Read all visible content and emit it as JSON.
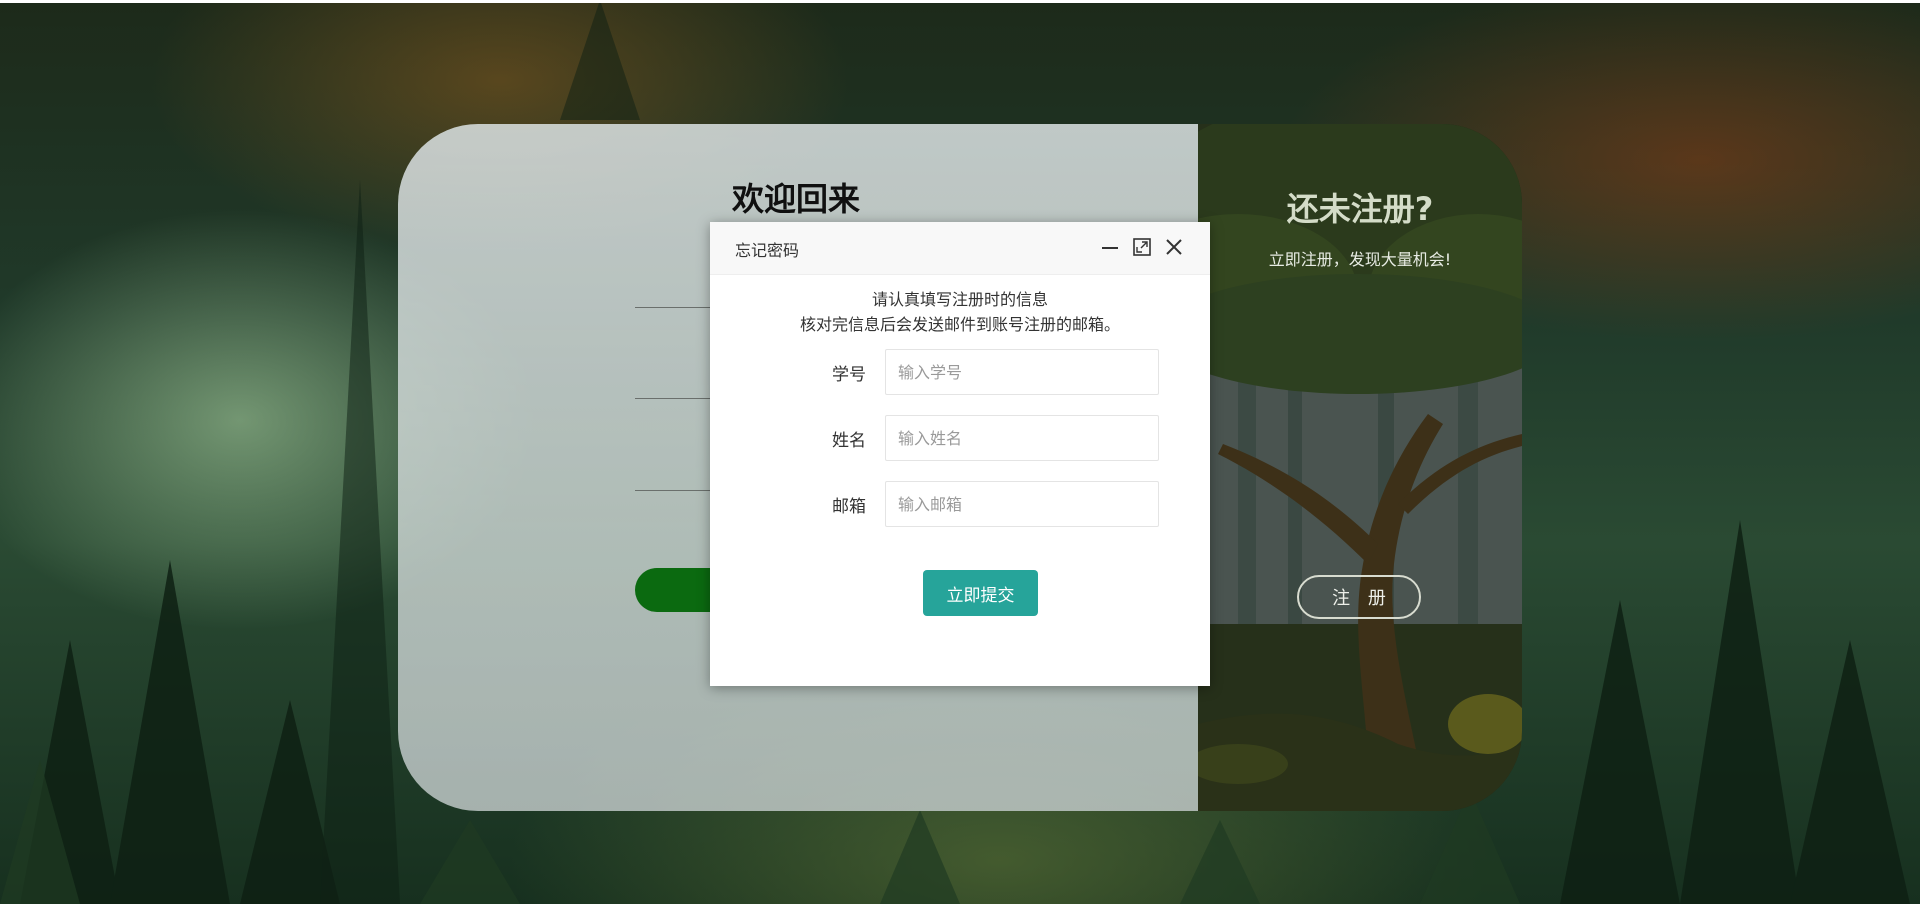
{
  "login": {
    "title": "欢迎回来"
  },
  "register_panel": {
    "title": "还未注册?",
    "subtitle": "立即注册，发现大量机会!",
    "button_label": "注 册"
  },
  "dialog": {
    "title": "忘记密码",
    "intro_line1": "请认真填写注册时的信息",
    "intro_line2": "核对完信息后会发送邮件到账号注册的邮箱。",
    "fields": [
      {
        "label": "学号",
        "placeholder": "输入学号",
        "value": ""
      },
      {
        "label": "姓名",
        "placeholder": "输入姓名",
        "value": ""
      },
      {
        "label": "邮箱",
        "placeholder": "输入邮箱",
        "value": ""
      }
    ],
    "submit_label": "立即提交",
    "controls": [
      "minimize-icon",
      "maximize-icon",
      "close-icon"
    ]
  },
  "colors": {
    "accent": "#26a49a",
    "login_button": "#0b6a10",
    "right_panel": "#2e3a20"
  }
}
